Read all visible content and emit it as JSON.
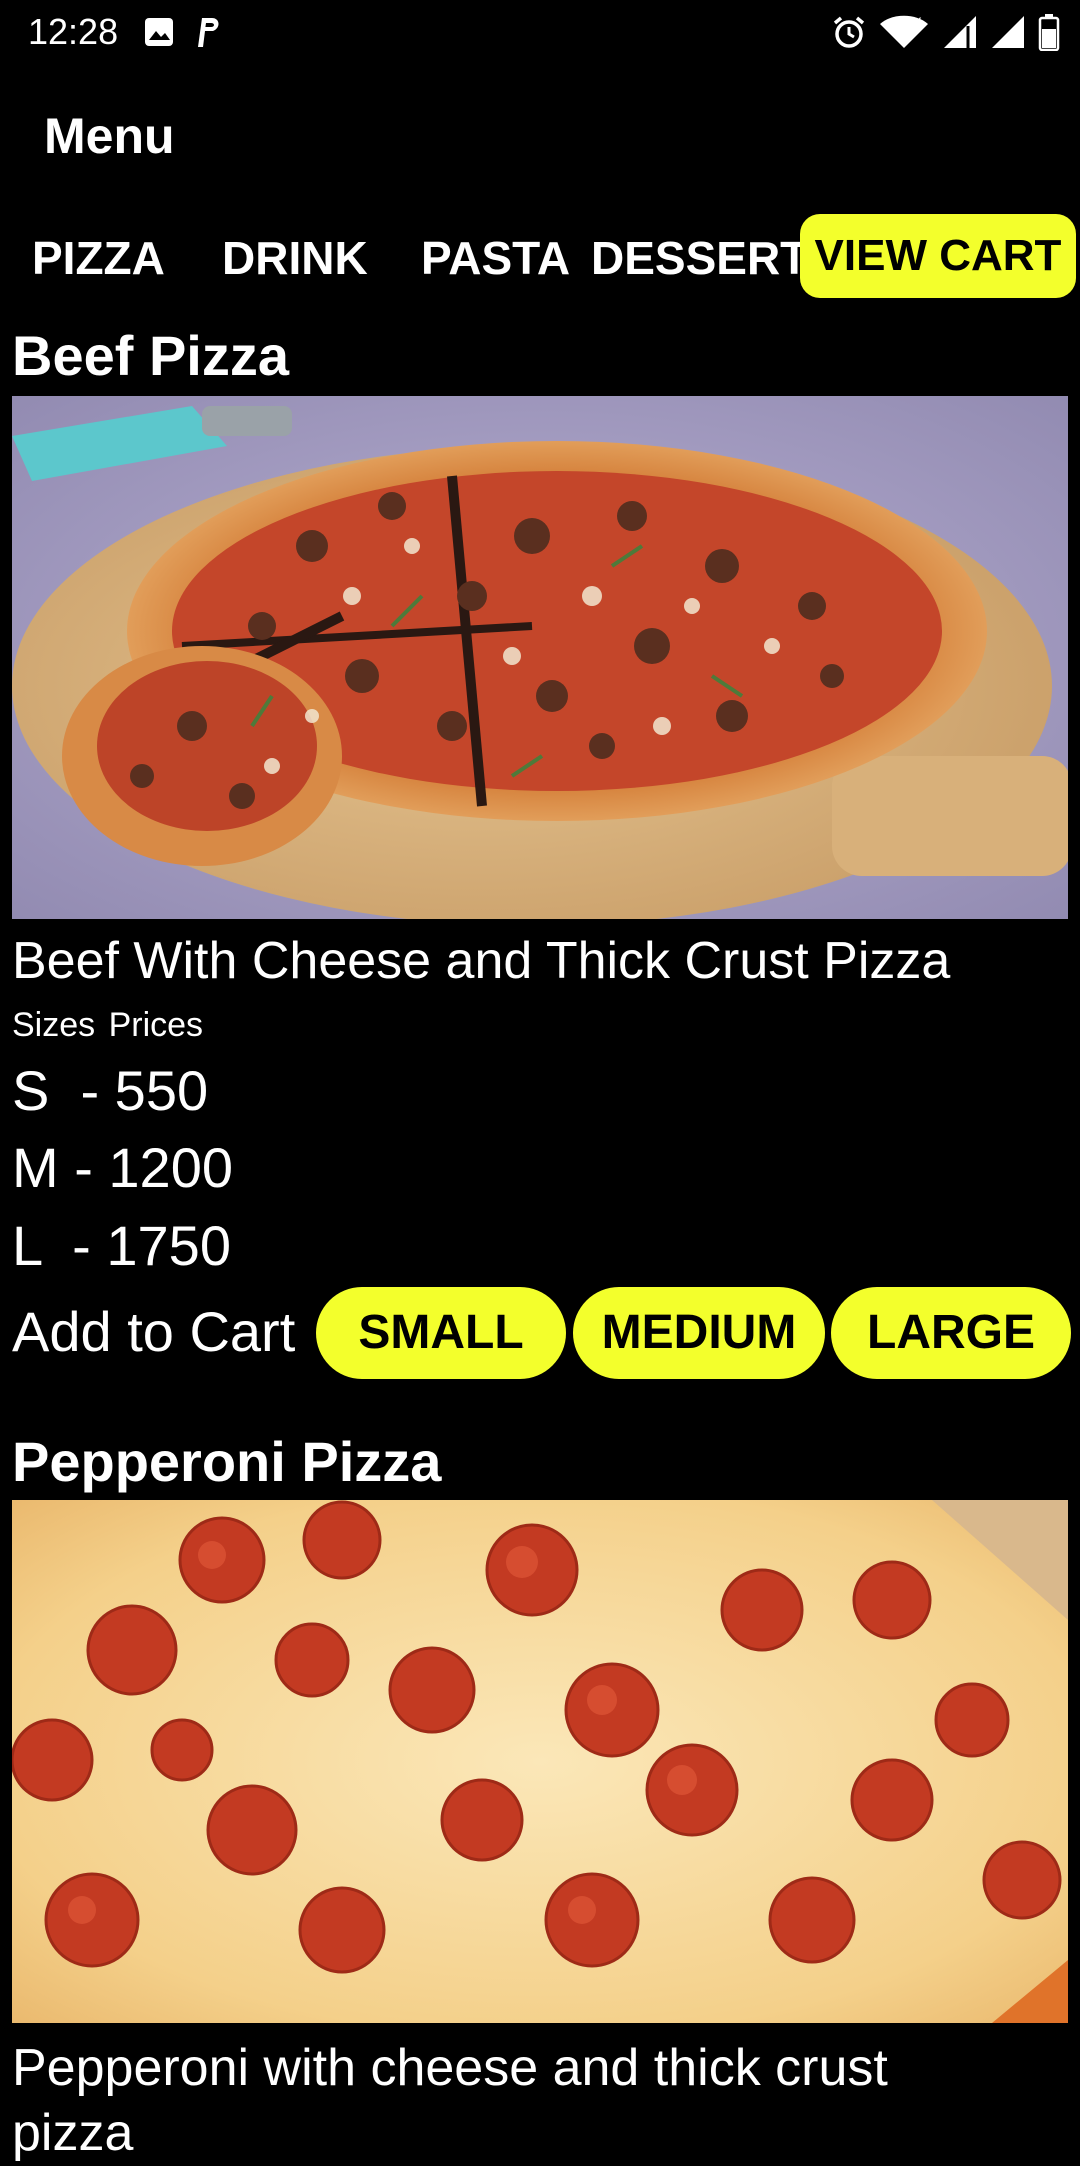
{
  "status_bar": {
    "time": "12:28",
    "left_icons": [
      "image-icon",
      "parking-icon"
    ],
    "right_icons": [
      "alarm-icon",
      "wifi-icon",
      "signal-icon",
      "signal-icon",
      "battery-icon"
    ]
  },
  "header": {
    "title": "Menu"
  },
  "tabs": [
    {
      "label": "PIZZA"
    },
    {
      "label": "DRINK"
    },
    {
      "label": "PASTA"
    },
    {
      "label": "DESSERT"
    }
  ],
  "cart_button": {
    "label": "VIEW CART"
  },
  "colors": {
    "background": "#000000",
    "accent_yellow": "#f3ff2c",
    "text": "#ffffff"
  },
  "products": [
    {
      "title": "Beef Pizza",
      "image": "beef-pizza-photo",
      "description": "Beef With Cheese and Thick Crust Pizza",
      "sizes_header": "Sizes Prices",
      "prices": [
        {
          "text": "S  - 550"
        },
        {
          "text": "M - 1200"
        },
        {
          "text": "L  - 1750"
        }
      ],
      "add_to_cart_label": "Add to Cart",
      "size_buttons": [
        "SMALL",
        "MEDIUM",
        "LARGE"
      ]
    },
    {
      "title": "Pepperoni Pizza",
      "image": "pepperoni-pizza-photo",
      "description_line1": "Pepperoni with cheese and thick crust",
      "description_line2": "pizza"
    }
  ]
}
